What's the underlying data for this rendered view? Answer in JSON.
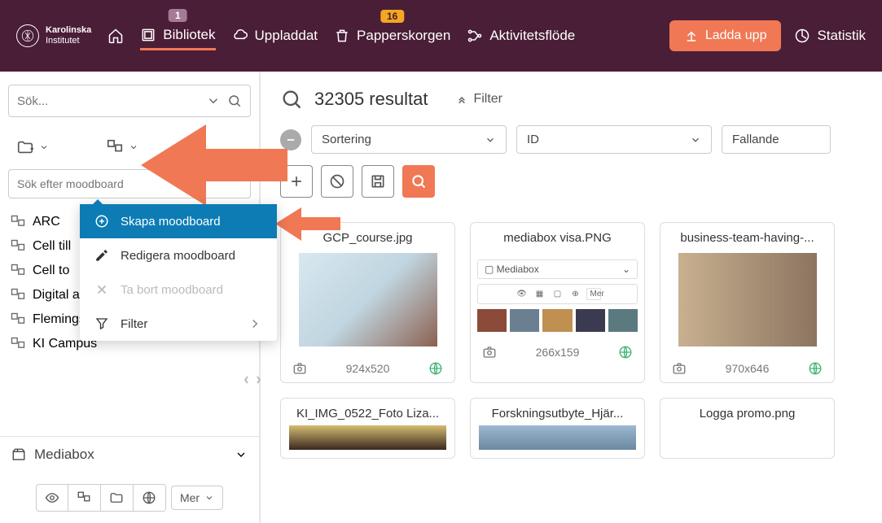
{
  "brand": {
    "line1": "Karolinska",
    "line2": "Institutet"
  },
  "nav": {
    "bibliotek": "Bibliotek",
    "bibliotek_badge": "1",
    "uppladdat": "Uppladdat",
    "papperskorgen": "Papperskorgen",
    "papperskorgen_badge": "16",
    "aktivitetsflode": "Aktivitetsflöde",
    "upload": "Ladda upp",
    "statistik": "Statistik"
  },
  "sidebar": {
    "search_placeholder": "Sök...",
    "moodboard_placeholder": "Sök efter moodboard",
    "folders": [
      "ARC",
      "Cell till",
      "Cell to",
      "Digital ambassadors",
      "Flemingsberg",
      "KI Campus"
    ],
    "mediabox": "Mediabox",
    "mer": "Mer"
  },
  "dropdown": {
    "create": "Skapa moodboard",
    "edit": "Redigera moodboard",
    "delete": "Ta bort moodboard",
    "filter": "Filter"
  },
  "content": {
    "result_count": "32305 resultat",
    "filter": "Filter",
    "sort": "Sortering",
    "id": "ID",
    "order": "Fallande"
  },
  "cards": [
    {
      "title": "GCP_course.jpg",
      "dims": "924x520"
    },
    {
      "title": "mediabox visa.PNG",
      "dims": "266x159",
      "mb_label": "Mediabox",
      "mb_mer": "Mer"
    },
    {
      "title": "business-team-having-...",
      "dims": "970x646"
    }
  ],
  "cards2": [
    {
      "title": "KI_IMG_0522_Foto Liza..."
    },
    {
      "title": "Forskningsutbyte_Hjär..."
    },
    {
      "title": "Logga promo.png"
    }
  ]
}
